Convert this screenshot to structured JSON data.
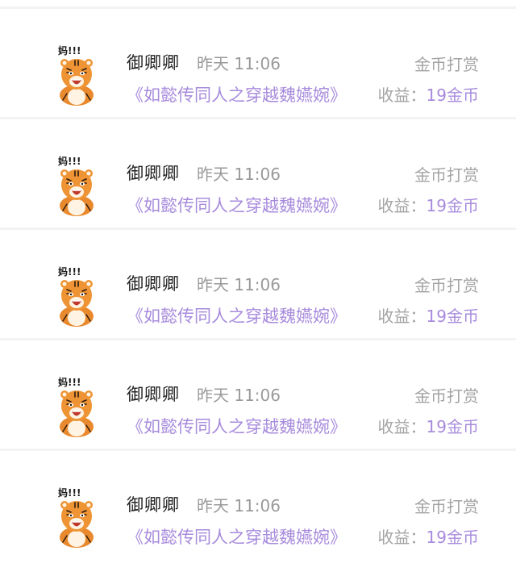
{
  "records": [
    {
      "name": "御卿卿",
      "time": "昨天 11:06",
      "reward_type": "金币打赏",
      "book": "《如懿传同人之穿越魏嬿婉》",
      "income_label": "收益：",
      "income_value": "19金币",
      "avatar_caption": "妈!!!",
      "avatar": "tiger-sticker"
    },
    {
      "name": "御卿卿",
      "time": "昨天 11:06",
      "reward_type": "金币打赏",
      "book": "《如懿传同人之穿越魏嬿婉》",
      "income_label": "收益：",
      "income_value": "19金币",
      "avatar_caption": "妈!!!",
      "avatar": "tiger-sticker"
    },
    {
      "name": "御卿卿",
      "time": "昨天 11:06",
      "reward_type": "金币打赏",
      "book": "《如懿传同人之穿越魏嬿婉》",
      "income_label": "收益：",
      "income_value": "19金币",
      "avatar_caption": "妈!!!",
      "avatar": "tiger-sticker"
    },
    {
      "name": "御卿卿",
      "time": "昨天 11:06",
      "reward_type": "金币打赏",
      "book": "《如懿传同人之穿越魏嬿婉》",
      "income_label": "收益：",
      "income_value": "19金币",
      "avatar_caption": "妈!!!",
      "avatar": "tiger-sticker"
    },
    {
      "name": "御卿卿",
      "time": "昨天 11:06",
      "reward_type": "金币打赏",
      "book": "《如懿传同人之穿越魏嬿婉》",
      "income_label": "收益：",
      "income_value": "19金币",
      "avatar_caption": "妈!!!",
      "avatar": "tiger-sticker"
    }
  ],
  "colors": {
    "accent": "#a78bdc",
    "name": "#222222",
    "muted": "#9a9a9a",
    "tiger_orange": "#e9892e"
  }
}
